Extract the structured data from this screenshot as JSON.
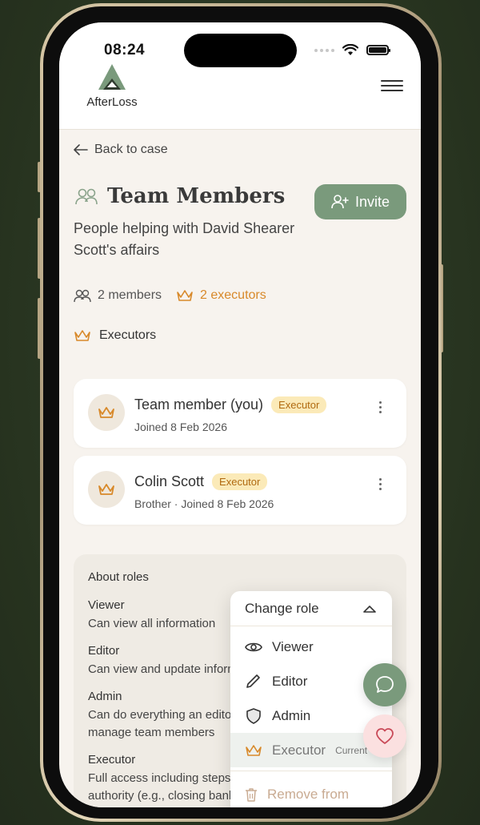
{
  "status_bar": {
    "time": "08:24"
  },
  "header": {
    "logo_text": "AfterLoss",
    "menu_icon": "hamburger-icon"
  },
  "nav": {
    "back_label": "Back to case"
  },
  "page": {
    "title": "Team Members",
    "subtitle": "People helping with David Shearer Scott's affairs",
    "invite_label": "Invite"
  },
  "stats": {
    "members": "2 members",
    "executors": "2 executors"
  },
  "section": {
    "executors_label": "Executors"
  },
  "members": [
    {
      "name": "Team member (you)",
      "badge": "Executor",
      "meta": "Joined 8 Feb 2026"
    },
    {
      "name": "Colin Scott",
      "badge": "Executor",
      "meta": "Brother · Joined 8 Feb 2026"
    }
  ],
  "roles": {
    "title": "About roles",
    "items": [
      {
        "name": "Viewer",
        "desc": "Can view all information"
      },
      {
        "name": "Editor",
        "desc": "Can view and update information and add notes"
      },
      {
        "name": "Admin",
        "desc": "Can do everything an editor can, plus invite and manage team members"
      },
      {
        "name": "Executor",
        "desc": "Full access including steps that require executor authority (e.g., closing bank accounts)"
      }
    ]
  },
  "dropdown": {
    "header": "Change role",
    "items": [
      {
        "label": "Viewer",
        "icon": "eye-icon"
      },
      {
        "label": "Editor",
        "icon": "pencil-icon"
      },
      {
        "label": "Admin",
        "icon": "shield-icon"
      },
      {
        "label": "Executor",
        "icon": "crown-icon",
        "tag": "Current"
      }
    ],
    "remove_label": "Remove from case"
  },
  "colors": {
    "accent": "#7a9a7c",
    "executor": "#d8892a",
    "badge_bg": "#fbeab8",
    "background": "#f7f3ee"
  }
}
